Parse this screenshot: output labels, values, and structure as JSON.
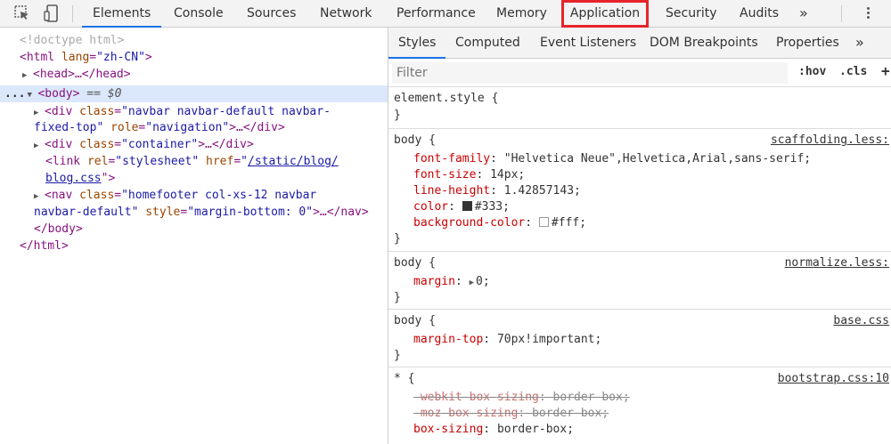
{
  "toolbar": {
    "tabs": [
      "Elements",
      "Console",
      "Sources",
      "Network",
      "Performance",
      "Memory",
      "Application",
      "Security",
      "Audits"
    ],
    "more": "»"
  },
  "dom": {
    "doctype": "<!doctype html>",
    "html_open_tag": "<html",
    "html_lang_attr": "lang",
    "html_lang_val": "\"zh-CN\"",
    "gt": ">",
    "head": "<head>…</head>",
    "dots": "...",
    "body_tag": "<body>",
    "body_eq": "== $0",
    "div_navbar_open": "<div",
    "class_attr": "class",
    "div_navbar_class_a": "\"navbar navbar-default navbar-",
    "div_navbar_class_b": "fixed-top\"",
    "role_attr": "role",
    "role_val": "\"navigation\"",
    "ellipsis_close_div": ">…</div>",
    "div_container_open": "<div",
    "div_container_class": "\"container\"",
    "link_open": "<link",
    "rel_attr": "rel",
    "rel_val": "\"stylesheet\"",
    "href_attr": "href",
    "href_quote_open": "\"",
    "href_val_a": "/static/blog/",
    "href_val_b": "blog.css",
    "href_close": "\">",
    "nav_open": "<nav",
    "nav_class_a": "\"homefooter col-xs-12 navbar",
    "nav_class_b": "navbar-default\"",
    "style_attr": "style",
    "style_val": "\"margin-bottom: 0\"",
    "nav_close": ">…</nav>",
    "body_close": "</body>",
    "html_close": "</html>",
    "eq_sign": "="
  },
  "styles_tabs": [
    "Styles",
    "Computed",
    "Event Listeners",
    "DOM Breakpoints",
    "Properties"
  ],
  "styles_more": "»",
  "filter": {
    "placeholder": "Filter",
    "hov": ":hov",
    "cls": ".cls",
    "plus": "+"
  },
  "rules": {
    "element_style": {
      "selector": "element.style {",
      "close": "}"
    },
    "r1": {
      "selector": "body {",
      "source": "scaffolding.less:",
      "props": [
        {
          "name": "font-family",
          "value": "\"Helvetica Neue\",Helvetica,Arial,sans-serif;"
        },
        {
          "name": "font-size",
          "value": "14px;"
        },
        {
          "name": "line-height",
          "value": "1.42857143;"
        },
        {
          "name": "color",
          "value": "#333;",
          "swatch": "#333333"
        },
        {
          "name": "background-color",
          "value": "#fff;",
          "swatch": "#ffffff"
        }
      ],
      "close": "}"
    },
    "r2": {
      "selector": "body {",
      "source": "normalize.less:",
      "prop_name": "margin",
      "prop_value": "0;",
      "close": "}"
    },
    "r3": {
      "selector": "body {",
      "source": "base.css",
      "prop_name": "margin-top",
      "prop_value": "70px!important;",
      "close": "}"
    },
    "r4": {
      "selector": "* {",
      "source": "bootstrap.css:10",
      "props": [
        {
          "name": "-webkit-box-sizing",
          "value": "border-box;",
          "struck": true
        },
        {
          "name": "-moz-box-sizing",
          "value": "border-box;",
          "struck": true
        },
        {
          "name": "box-sizing",
          "value": "border-box;",
          "struck": false
        }
      ]
    }
  },
  "colon": ":"
}
